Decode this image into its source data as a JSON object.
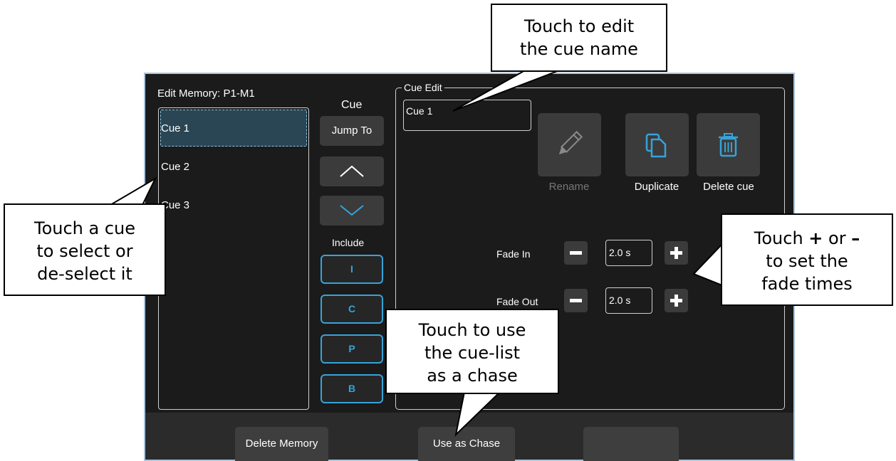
{
  "window": {
    "title": "Edit Memory: P1-M1",
    "cue_header": "Cue",
    "jump_to": "Jump To",
    "include_label": "Include",
    "include_buttons": [
      "I",
      "C",
      "P",
      "B"
    ]
  },
  "cue_list": [
    {
      "label": "Cue 1",
      "selected": true
    },
    {
      "label": "Cue 2",
      "selected": false
    },
    {
      "label": "Cue 3",
      "selected": false
    }
  ],
  "cue_edit": {
    "legend": "Cue Edit",
    "name_value": "Cue 1",
    "rename_label": "Rename",
    "duplicate_label": "Duplicate",
    "delete_label": "Delete cue",
    "fade_in_label": "Fade In",
    "fade_in_value": "2.0 s",
    "fade_out_label": "Fade Out",
    "fade_out_value": "2.0 s"
  },
  "bottom_bar": {
    "delete_memory": "Delete Memory",
    "use_as_chase": "Use as Chase",
    "blank_button": ""
  },
  "callouts": {
    "edit_name": [
      "Touch to edit",
      "the cue name"
    ],
    "select_cue": [
      "Touch a cue",
      "to select or",
      "de-select it"
    ],
    "fade": [
      "to set the",
      "fade times"
    ],
    "fade_prefix": "Touch ",
    "fade_plus": "+",
    "fade_or": " or ",
    "fade_minus": "–",
    "chase": [
      "Touch to use",
      "the cue-list",
      "as a chase"
    ]
  },
  "colors": {
    "window_bg": "#1b1b1b",
    "window_border": "#a9c4dd",
    "accent_blue": "#37a3d9",
    "selected_row": "#2a4553",
    "button_gray": "#3b3b3b"
  }
}
